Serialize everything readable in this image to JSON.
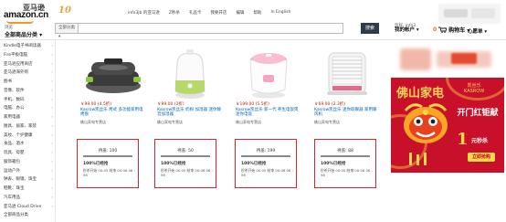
{
  "header": {
    "logo_cn": "亚马逊",
    "logo_en": "amazon.cn",
    "logo_badge": "10",
    "nav": [
      "info3jb 的亚马逊",
      "Z秒杀",
      "礼品卡",
      "我要开店",
      "编辑",
      "帮助",
      "In English"
    ],
    "category_label": "浏览",
    "category_title": "全部商品分类 ▾",
    "search_select": "全部分类 ▾",
    "search_placeholder": "",
    "search_button": "搜索",
    "account_greeting": "您好, info3",
    "account_label": "我的帐户 ▾",
    "cart_count": "0",
    "cart_label": "购物车 ▾",
    "wishlist_label": "心愿单 ▾",
    "colors": {
      "accent": "#f29a1f",
      "search_btn": "#2f3a4a",
      "deal_border": "#d2262c",
      "price": "#b12704",
      "link": "#0066c0"
    }
  },
  "sidebar": {
    "items": [
      "Kindle电子书阅读器",
      "Fire平板电脑",
      "亚马逊应用商店",
      "亚马逊海外购",
      "图书",
      "音像、软件",
      "手机、数码",
      "电脑、办公",
      "家用电器",
      "厨具、居家、家装",
      "美妆、个护健康",
      "食品、酒水",
      "玩具、母婴",
      "服饰箱包",
      "运动户外",
      "钟表、眼镜、珠宝",
      "鞋靴、珠宝",
      "汽车用品",
      "亚马逊 Cloud Drive",
      "全部商品分类"
    ]
  },
  "products": [
    {
      "price": "￥99.00 (4.5折)",
      "name": "Kasrow凯丝乐 烤式 多功能家用电烤盘",
      "desc": "佛山家电专营店",
      "deal_qty": "待盖: 100",
      "deal_progress": 1.0,
      "deal_status": "100%已经抢",
      "deal_time": "秒杀开始 00:05 结束 00:06 06 : 56"
    },
    {
      "price": "￥99.00 (2折)",
      "name": "Kasrow凯丝乐 奶粉 加湿器 迷你静音加湿器",
      "desc": "佛山家电专营店",
      "deal_qty": "待盖: 50",
      "deal_progress": 1.0,
      "deal_status": "100%已经抢",
      "deal_time": "秒杀开始 00:05 结束 00:06 06 : 56"
    },
    {
      "price": "￥199.00 (5.5折)",
      "name": "Kasrow凯丝乐 新一代 养生电饭煲 迷你电饭",
      "desc": "佛山家电专营店",
      "deal_qty": "待盖: 199",
      "deal_progress": 1.0,
      "deal_status": "100%已经抢",
      "deal_time": "秒杀开始 00:05 结束 00:06 06 : 56"
    },
    {
      "price": "￥69.00 (2.3折)",
      "name": "Kasrow凯丝乐 迷你取暖器 家用暖风机",
      "desc": "佛山家电专营店",
      "deal_qty": "待盖: 88",
      "deal_progress": 1.0,
      "deal_status": "100%已经抢",
      "deal_time": "秒杀开始 00:05 结束 00:06 06 : 56"
    }
  ],
  "ad": {
    "brand_big": "佛山家电",
    "brand_small": "凯丝乐\nKASROW",
    "headline": "开门红钜献",
    "price": "1",
    "price_sub": "元秒杀",
    "button": "立即抢购"
  }
}
